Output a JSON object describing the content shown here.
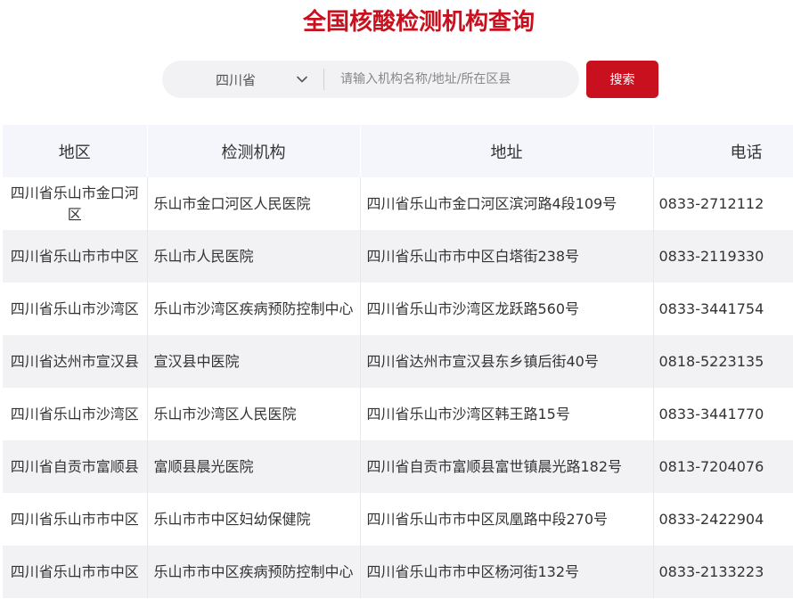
{
  "page": {
    "title": "全国核酸检测机构查询"
  },
  "search": {
    "province_selected": "四川省",
    "placeholder": "请输入机构名称/地址/所在区县",
    "button_label": "搜索"
  },
  "table": {
    "headers": [
      "地区",
      "检测机构",
      "地址",
      "电话"
    ],
    "rows": [
      [
        "四川省乐山市金口河区",
        "乐山市金口河区人民医院",
        "四川省乐山市金口河区滨河路4段109号",
        "0833-2712112"
      ],
      [
        "四川省乐山市市中区",
        "乐山市人民医院",
        "四川省乐山市市中区白塔街238号",
        "0833-2119330"
      ],
      [
        "四川省乐山市沙湾区",
        "乐山市沙湾区疾病预防控制中心",
        "四川省乐山市沙湾区龙跃路560号",
        "0833-3441754"
      ],
      [
        "四川省达州市宣汉县",
        "宣汉县中医院",
        "四川省达州市宣汉县东乡镇后街40号",
        "0818-5223135"
      ],
      [
        "四川省乐山市沙湾区",
        "乐山市沙湾区人民医院",
        "四川省乐山市沙湾区韩王路15号",
        "0833-3441770"
      ],
      [
        "四川省自贡市富顺县",
        "富顺县晨光医院",
        "四川省自贡市富顺县富世镇晨光路182号",
        "0813-7204076"
      ],
      [
        "四川省乐山市市中区",
        "乐山市市中区妇幼保健院",
        "四川省乐山市市中区凤凰路中段270号",
        "0833-2422904"
      ],
      [
        "四川省乐山市市中区",
        "乐山市市中区疾病预防控制中心",
        "四川省乐山市市中区杨河街132号",
        "0833-2133223"
      ]
    ]
  },
  "colors": {
    "accent": "#c8101e",
    "header_bg": "#f4f6fb",
    "stripe_bg": "#f2f2f4"
  },
  "icons": {
    "dropdown": "chevron-down-icon"
  }
}
